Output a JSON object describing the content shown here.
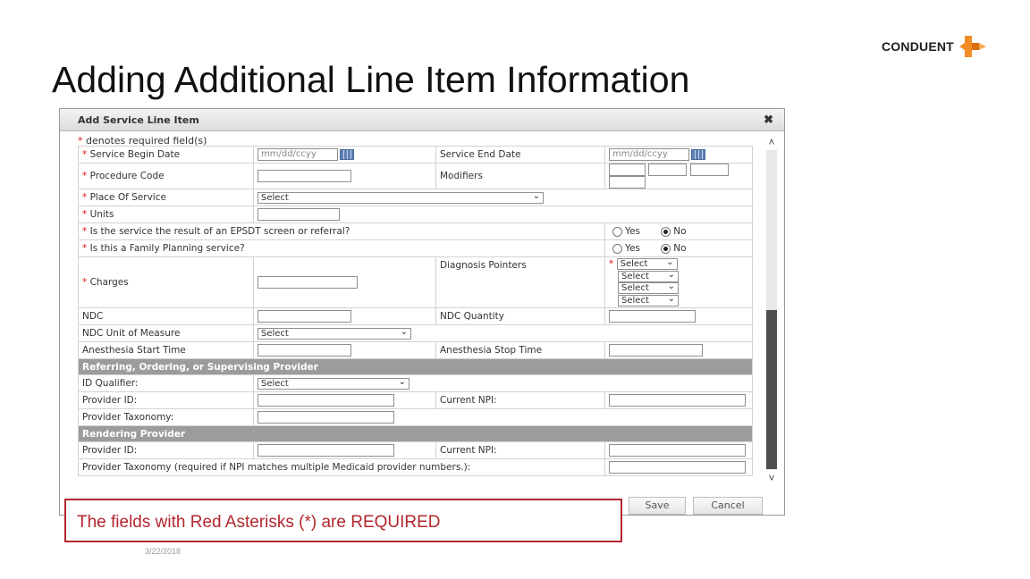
{
  "slide": {
    "title": "Adding Additional Line Item Information",
    "logo_text": "CONDUENT",
    "callout": "The fields with Red Asterisks (*) are REQUIRED",
    "date": "3/22/2018"
  },
  "dialog": {
    "title": "Add Service Line Item",
    "close_symbol": "✖",
    "required_note": "denotes required field(s)",
    "star": "*",
    "date_placeholder": "mm/dd/ccyy",
    "select_placeholder": "Select",
    "yes_label": "Yes",
    "no_label": "No",
    "labels": {
      "service_begin_date": "Service Begin Date",
      "service_end_date": "Service End Date",
      "procedure_code": "Procedure Code",
      "modifiers": "Modifiers",
      "place_of_service": "Place Of Service",
      "units": "Units",
      "epsdt": "Is the service the result of an EPSDT screen or referral?",
      "family_planning": "Is this a Family Planning service?",
      "diagnosis_pointers": "Diagnosis Pointers",
      "charges": "Charges",
      "ndc": "NDC",
      "ndc_quantity": "NDC Quantity",
      "ndc_unit": "NDC Unit of Measure",
      "anesthesia_start": "Anesthesia Start Time",
      "anesthesia_stop": "Anesthesia Stop Time",
      "referring_section": "Referring, Ordering, or Supervising Provider",
      "id_qualifier": "ID Qualifier:",
      "provider_id": "Provider ID:",
      "current_npi": "Current NPI:",
      "provider_taxonomy": "Provider Taxonomy:",
      "rendering_section": "Rendering Provider",
      "rendering_provider_id": "Provider ID:",
      "rendering_current_npi": "Current NPI:",
      "rendering_taxonomy": "Provider Taxonomy (required if NPI matches multiple Medicaid provider numbers.):"
    },
    "values": {
      "epsdt": "No",
      "family_planning": "No"
    },
    "buttons": {
      "save": "Save",
      "cancel": "Cancel"
    }
  },
  "icons": {
    "calendar": "calendar-icon",
    "chevron": "chevron-down-icon",
    "scroll_up": "˄",
    "scroll_down": "˅"
  },
  "colors": {
    "required_star": "#dd1111",
    "callout_border": "#b3262e",
    "section_header": "#9c9c9c",
    "logo_orange": "#f28c28"
  }
}
